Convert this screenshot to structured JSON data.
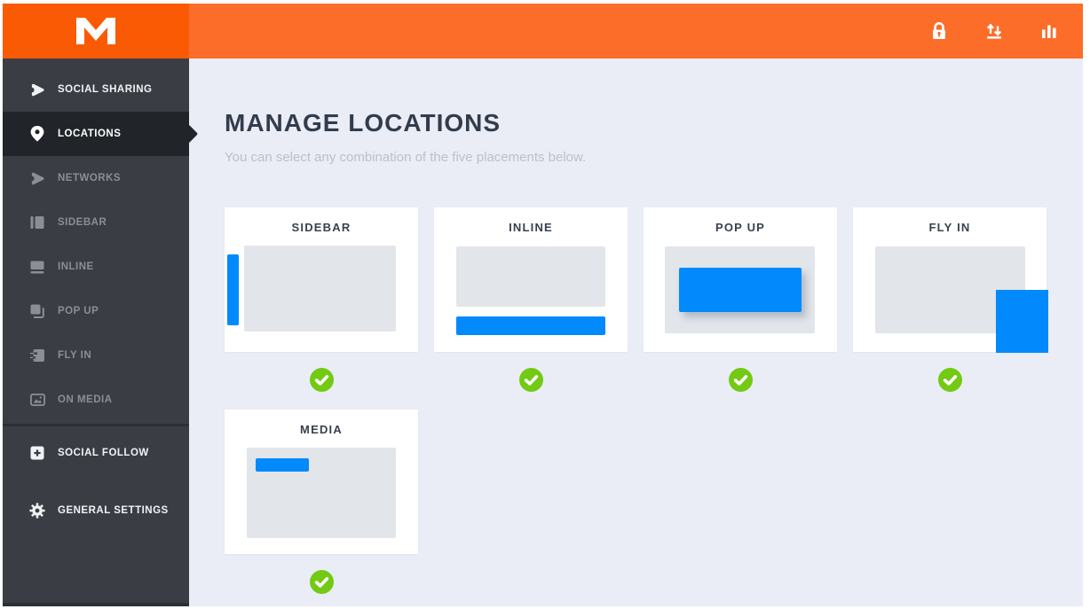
{
  "header": {
    "logo_label": "M",
    "actions": [
      {
        "icon": "lock-icon"
      },
      {
        "icon": "import-export-icon"
      },
      {
        "icon": "stats-icon"
      }
    ]
  },
  "sidebar": {
    "items": [
      {
        "label": "SOCIAL SHARING",
        "icon": "share-icon",
        "level": "primary",
        "active": false
      },
      {
        "label": "LOCATIONS",
        "icon": "location-pin-icon",
        "level": "sub",
        "active": true
      },
      {
        "label": "NETWORKS",
        "icon": "share-icon",
        "level": "sub",
        "active": false
      },
      {
        "label": "SIDEBAR",
        "icon": "sidebar-icon",
        "level": "sub",
        "active": false
      },
      {
        "label": "INLINE",
        "icon": "inline-icon",
        "level": "sub",
        "active": false
      },
      {
        "label": "POP UP",
        "icon": "popup-icon",
        "level": "sub",
        "active": false
      },
      {
        "label": "FLY IN",
        "icon": "fly-in-icon",
        "level": "sub",
        "active": false
      },
      {
        "label": "ON MEDIA",
        "icon": "on-media-icon",
        "level": "sub",
        "active": false
      },
      {
        "label": "SOCIAL FOLLOW",
        "icon": "social-follow-icon",
        "level": "primary",
        "active": false
      },
      {
        "label": "GENERAL SETTINGS",
        "icon": "settings-icon",
        "level": "primary",
        "active": false
      }
    ]
  },
  "main": {
    "title": "MANAGE LOCATIONS",
    "subtitle": "You can select any combination of the five placements below.",
    "placements": [
      {
        "label": "SIDEBAR",
        "selected": true
      },
      {
        "label": "INLINE",
        "selected": true
      },
      {
        "label": "POP UP",
        "selected": true
      },
      {
        "label": "FLY IN",
        "selected": true
      },
      {
        "label": "MEDIA",
        "selected": true
      }
    ]
  },
  "colors": {
    "logo_orange": "#fb5a05",
    "topbar_orange": "#fc6d2a",
    "sidebar_bg": "#3a3d44",
    "sidebar_active_bg": "#212428",
    "content_bg": "#eaedf6",
    "accent_blue": "#028afc",
    "success_green": "#72ca12"
  }
}
